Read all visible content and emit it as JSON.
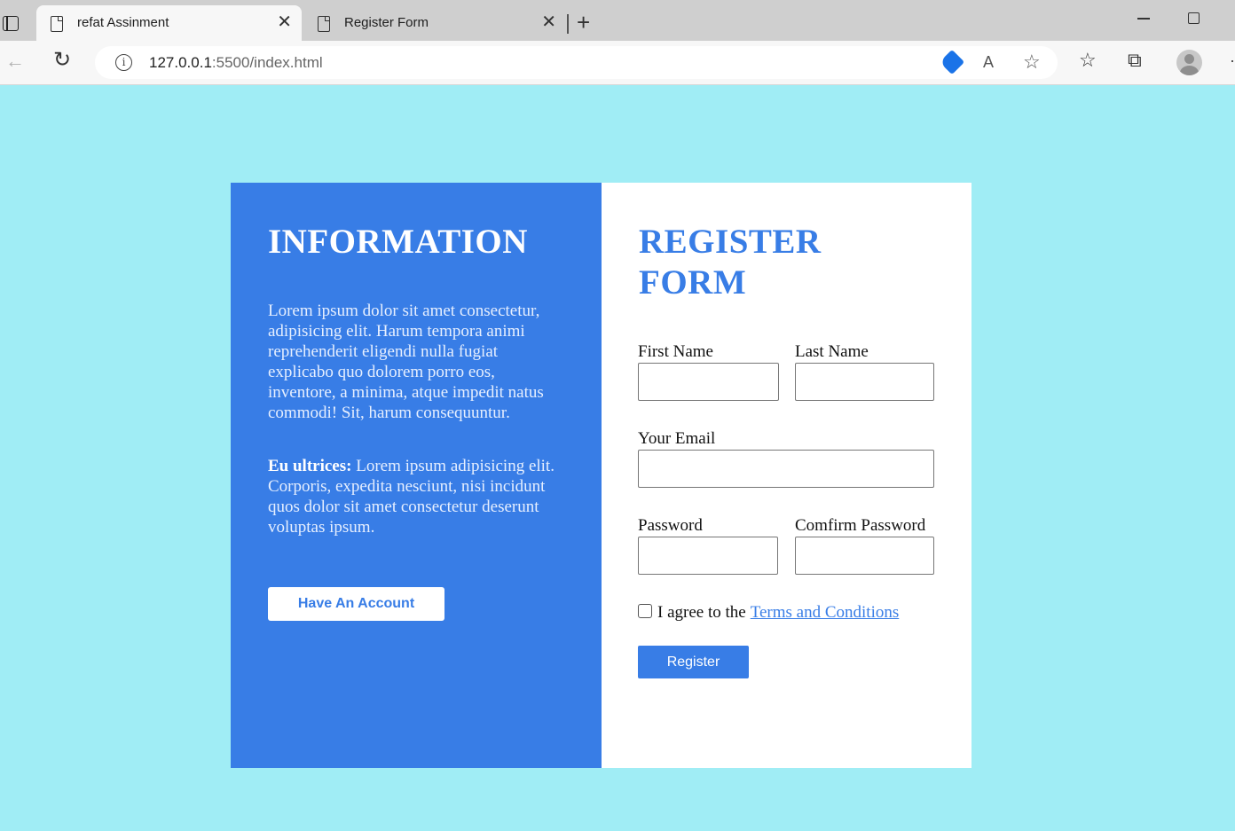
{
  "browser": {
    "tabs": [
      {
        "title": "refat Assinment",
        "active": true
      },
      {
        "title": "Register Form",
        "active": false
      }
    ],
    "url_host": "127.0.0.1",
    "url_rest": ":5500/index.html",
    "accent": "#1a73e8"
  },
  "info": {
    "title": "INFORMATION",
    "paragraph1": "Lorem ipsum dolor sit amet consectetur, adipisicing elit. Harum tempora animi reprehenderit eligendi nulla fugiat explicabo quo dolorem porro eos, inventore, a minima, atque impedit natus commodi! Sit, harum consequuntur.",
    "paragraph2_bold": "Eu ultrices:",
    "paragraph2_text": " Lorem ipsum adipisicing elit. Corporis, expedita nesciunt, nisi incidunt quos dolor sit amet consectetur deserunt voluptas ipsum.",
    "have_account_label": "Have An Account",
    "panel_color": "#387de6"
  },
  "form": {
    "title": "REGISTER FORM",
    "first_name_label": "First Name",
    "last_name_label": "Last Name",
    "email_label": "Your Email",
    "password_label": "Password",
    "confirm_password_label": "Comfirm Password",
    "agree_text": "I agree to the",
    "terms_link": "Terms and Conditions",
    "register_label": "Register"
  },
  "page": {
    "background": "#a0edf5"
  }
}
